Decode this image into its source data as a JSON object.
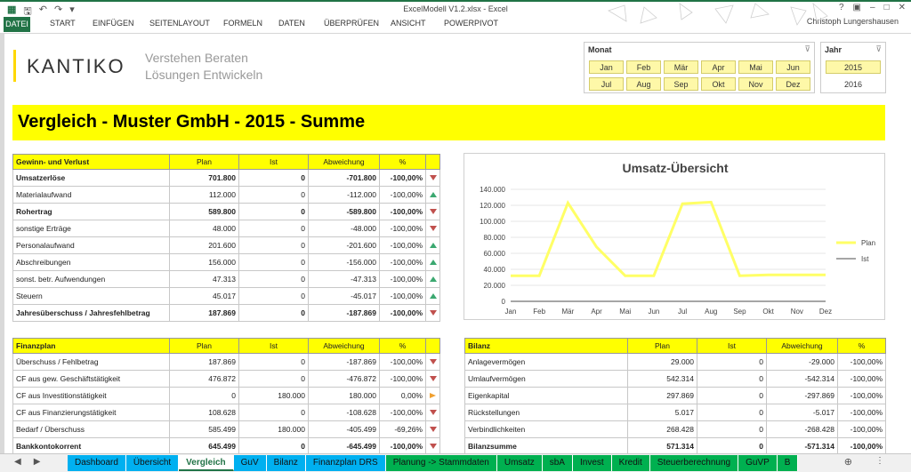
{
  "window": {
    "title": "ExcelModell V1.2.xlsx - Excel",
    "user": "Christoph Lungershausen"
  },
  "ribbon": {
    "tabs": [
      "DATEI",
      "START",
      "EINFÜGEN",
      "SEITENLAYOUT",
      "FORMELN",
      "DATEN",
      "ÜBERPRÜFEN",
      "ANSICHT",
      "POWERPIVOT"
    ]
  },
  "brand": {
    "logo": "KANTIKO",
    "tagline1": "Verstehen Beraten",
    "tagline2": "Lösungen Entwickeln",
    "accent": "#ffd800"
  },
  "slicer_month": {
    "header": "Monat",
    "months": [
      "Jan",
      "Feb",
      "Mär",
      "Apr",
      "Mai",
      "Jun",
      "Jul",
      "Aug",
      "Sep",
      "Okt",
      "Nov",
      "Dez"
    ]
  },
  "slicer_year": {
    "header": "Jahr",
    "years": [
      "2015",
      "2016"
    ],
    "selected": "2015"
  },
  "report_title": "Vergleich - Muster GmbH - 2015 - Summe",
  "guv": {
    "headers": [
      "Gewinn- und Verlust",
      "Plan",
      "Ist",
      "Abweichung",
      "%"
    ],
    "rows": [
      {
        "label": "Umsatzerlöse",
        "plan": "701.800",
        "ist": "0",
        "abw": "-701.800",
        "pct": "-100,00%",
        "ind": "down",
        "bold": true
      },
      {
        "label": "Materialaufwand",
        "plan": "112.000",
        "ist": "0",
        "abw": "-112.000",
        "pct": "-100,00%",
        "ind": "up",
        "bold": false
      },
      {
        "label": "Rohertrag",
        "plan": "589.800",
        "ist": "0",
        "abw": "-589.800",
        "pct": "-100,00%",
        "ind": "down",
        "bold": true
      },
      {
        "label": "sonstige Erträge",
        "plan": "48.000",
        "ist": "0",
        "abw": "-48.000",
        "pct": "-100,00%",
        "ind": "down",
        "bold": false
      },
      {
        "label": "Personalaufwand",
        "plan": "201.600",
        "ist": "0",
        "abw": "-201.600",
        "pct": "-100,00%",
        "ind": "up",
        "bold": false
      },
      {
        "label": "Abschreibungen",
        "plan": "156.000",
        "ist": "0",
        "abw": "-156.000",
        "pct": "-100,00%",
        "ind": "up",
        "bold": false
      },
      {
        "label": "sonst. betr. Aufwendungen",
        "plan": "47.313",
        "ist": "0",
        "abw": "-47.313",
        "pct": "-100,00%",
        "ind": "up",
        "bold": false
      },
      {
        "label": "Steuern",
        "plan": "45.017",
        "ist": "0",
        "abw": "-45.017",
        "pct": "-100,00%",
        "ind": "up",
        "bold": false
      },
      {
        "label": "Jahresüberschuss / Jahresfehlbetrag",
        "plan": "187.869",
        "ist": "0",
        "abw": "-187.869",
        "pct": "-100,00%",
        "ind": "down",
        "bold": true
      }
    ]
  },
  "finanzplan": {
    "headers": [
      "Finanzplan",
      "Plan",
      "Ist",
      "Abweichung",
      "%"
    ],
    "rows": [
      {
        "label": "Überschuss / Fehlbetrag",
        "plan": "187.869",
        "ist": "0",
        "abw": "-187.869",
        "pct": "-100,00%",
        "ind": "down",
        "bold": false
      },
      {
        "label": "CF aus gew. Geschäftstätigkeit",
        "plan": "476.872",
        "ist": "0",
        "abw": "-476.872",
        "pct": "-100,00%",
        "ind": "down",
        "bold": false
      },
      {
        "label": "CF aus Investitionstätigkeit",
        "plan": "0",
        "ist": "180.000",
        "abw": "180.000",
        "pct": "0,00%",
        "ind": "side",
        "bold": false
      },
      {
        "label": "CF aus Finanzierungstätigkeit",
        "plan": "108.628",
        "ist": "0",
        "abw": "-108.628",
        "pct": "-100,00%",
        "ind": "down",
        "bold": false
      },
      {
        "label": "Bedarf / Überschuss",
        "plan": "585.499",
        "ist": "180.000",
        "abw": "-405.499",
        "pct": "-69,26%",
        "ind": "down",
        "bold": false
      },
      {
        "label": "Bankkontokorrent",
        "plan": "645.499",
        "ist": "0",
        "abw": "-645.499",
        "pct": "-100,00%",
        "ind": "down",
        "bold": true
      }
    ]
  },
  "bilanz": {
    "headers": [
      "Bilanz",
      "Plan",
      "Ist",
      "Abweichung",
      "%"
    ],
    "rows": [
      {
        "label": "Anlagevermögen",
        "plan": "29.000",
        "ist": "0",
        "abw": "-29.000",
        "pct": "-100,00%",
        "bold": false
      },
      {
        "label": "Umlaufvermögen",
        "plan": "542.314",
        "ist": "0",
        "abw": "-542.314",
        "pct": "-100,00%",
        "bold": false
      },
      {
        "label": "Eigenkapital",
        "plan": "297.869",
        "ist": "0",
        "abw": "-297.869",
        "pct": "-100,00%",
        "bold": false
      },
      {
        "label": "Rückstellungen",
        "plan": "5.017",
        "ist": "0",
        "abw": "-5.017",
        "pct": "-100,00%",
        "bold": false
      },
      {
        "label": "Verbindlichkeiten",
        "plan": "268.428",
        "ist": "0",
        "abw": "-268.428",
        "pct": "-100,00%",
        "bold": false
      },
      {
        "label": "Bilanzsumme",
        "plan": "571.314",
        "ist": "0",
        "abw": "-571.314",
        "pct": "-100,00%",
        "bold": true
      }
    ]
  },
  "chart_data": {
    "type": "line",
    "title": "Umsatz-Übersicht",
    "categories": [
      "Jan",
      "Feb",
      "Mär",
      "Apr",
      "Mai",
      "Jun",
      "Jul",
      "Aug",
      "Sep",
      "Okt",
      "Nov",
      "Dez"
    ],
    "series": [
      {
        "name": "Plan",
        "values": [
          32000,
          32000,
          123000,
          68000,
          32000,
          32000,
          122000,
          124000,
          32000,
          33000,
          33000,
          33000
        ],
        "color": "#ffff66"
      },
      {
        "name": "Ist",
        "values": [
          0,
          0,
          0,
          0,
          0,
          0,
          0,
          0,
          0,
          0,
          0,
          0
        ],
        "color": "#888888"
      }
    ],
    "yticks": [
      "0",
      "20.000",
      "40.000",
      "60.000",
      "80.000",
      "100.000",
      "120.000",
      "140.000"
    ],
    "ylim": [
      0,
      140000
    ],
    "legend": "right",
    "grid": true
  },
  "sheet_tabs": [
    {
      "label": "Dashboard",
      "color": "blue"
    },
    {
      "label": "Übersicht",
      "color": "blue"
    },
    {
      "label": "Vergleich",
      "color": "active"
    },
    {
      "label": "GuV",
      "color": "blue"
    },
    {
      "label": "Bilanz",
      "color": "blue"
    },
    {
      "label": "Finanzplan DRS",
      "color": "blue"
    },
    {
      "label": "Planung -> Stammdaten",
      "color": "green"
    },
    {
      "label": "Umsatz",
      "color": "green"
    },
    {
      "label": "sbA",
      "color": "green"
    },
    {
      "label": "Invest",
      "color": "green"
    },
    {
      "label": "Kredit",
      "color": "green"
    },
    {
      "label": "Steuerberechnung",
      "color": "green"
    },
    {
      "label": "GuVP",
      "color": "green"
    },
    {
      "label": "B",
      "color": "green"
    }
  ]
}
